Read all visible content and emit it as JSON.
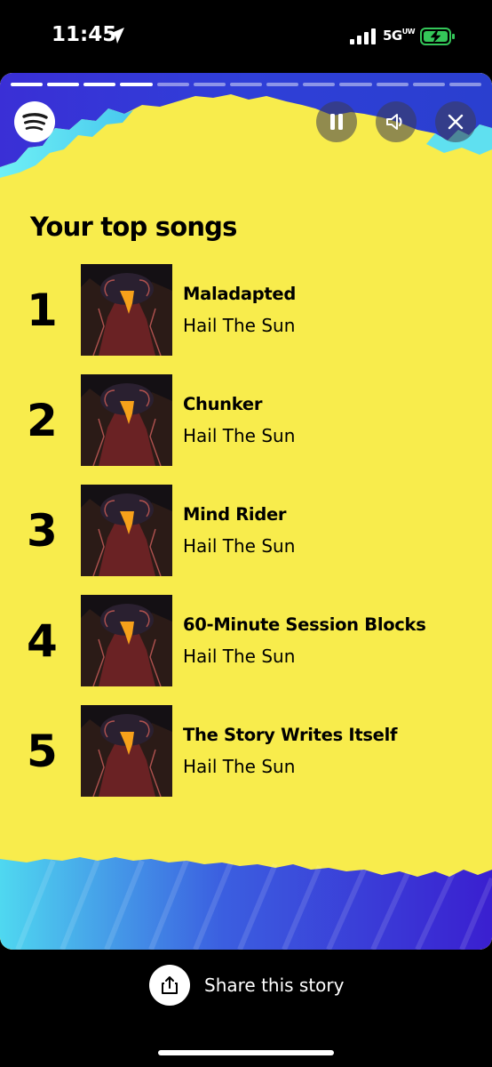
{
  "status_bar": {
    "time": "11:45",
    "network": "5G",
    "network_sup": "UW",
    "icons": [
      "location-arrow-icon",
      "signal-bars-icon",
      "battery-charging-icon"
    ]
  },
  "story": {
    "progress_segments_total": 13,
    "progress_segments_done": 4,
    "title": "Your top songs",
    "songs": [
      {
        "rank": "1",
        "title": "Maladapted",
        "artist": "Hail The Sun"
      },
      {
        "rank": "2",
        "title": "Chunker",
        "artist": "Hail The Sun"
      },
      {
        "rank": "3",
        "title": "Mind Rider",
        "artist": "Hail The Sun"
      },
      {
        "rank": "4",
        "title": "60-Minute Session Blocks",
        "artist": "Hail The Sun"
      },
      {
        "rank": "5",
        "title": "The Story Writes Itself",
        "artist": "Hail The Sun"
      }
    ],
    "controls": [
      "pause-icon",
      "sound-icon",
      "close-icon"
    ]
  },
  "share": {
    "label": "Share this story",
    "icon": "share-icon"
  },
  "colors": {
    "background": "#000000",
    "card_yellow": "#f8ec4c",
    "accent_blue": "#3b2fd0",
    "accent_cyan": "#5fe3f0",
    "text": "#000000"
  }
}
